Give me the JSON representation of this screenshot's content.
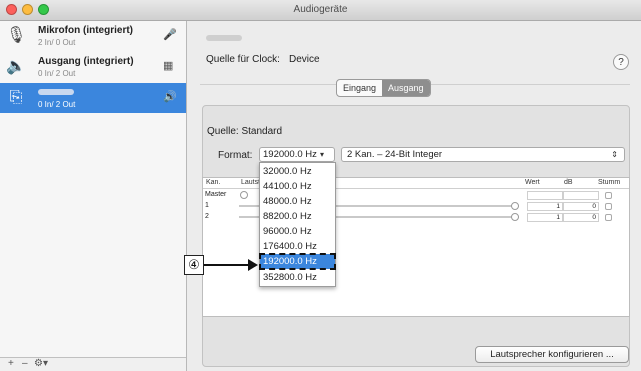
{
  "window": {
    "title": "Audiogeräte"
  },
  "sidebar": {
    "devices": [
      {
        "name": "Mikrofon (integriert)",
        "io": "2 In/ 0 Out",
        "icon": "microphone-icon"
      },
      {
        "name": "Ausgang (integriert)",
        "io": "0 In/ 2 Out",
        "icon": "speaker-icon"
      },
      {
        "name": "",
        "io": "0 In/ 2 Out",
        "icon": "usb-icon",
        "selected": true
      }
    ],
    "footer": {
      "add": "+",
      "remove": "–",
      "gear": "⚙▾"
    }
  },
  "main": {
    "clock_label": "Quelle für Clock:",
    "clock_value": "Device",
    "help": "?",
    "tabs": [
      {
        "label": "Eingang"
      },
      {
        "label": "Ausgang",
        "active": true
      }
    ],
    "source_label": "Quelle:",
    "source_value": "Standard",
    "format_label": "Format:",
    "format_value": "192000.0 Hz",
    "channels_value": "2 Kan. – 24-Bit Integer",
    "table": {
      "headers": {
        "kan": "Kan.",
        "laut": "Lautst",
        "wert": "Wert",
        "db": "dB",
        "stumm": "Stumm"
      },
      "rows": [
        {
          "label": "Master",
          "value": "",
          "db": ""
        },
        {
          "label": "1",
          "value": "1",
          "db": "0"
        },
        {
          "label": "2",
          "value": "1",
          "db": "0"
        }
      ]
    },
    "speaker_button": "Lautsprecher konfigurieren ..."
  },
  "dropdown": {
    "options": [
      "32000.0 Hz",
      "44100.0 Hz",
      "48000.0 Hz",
      "88200.0 Hz",
      "96000.0 Hz",
      "176400.0 Hz",
      "192000.0 Hz",
      "352800.0 Hz"
    ],
    "selected": "192000.0 Hz"
  },
  "callout": {
    "label": "④"
  },
  "colors": {
    "selection": "#3b86dd",
    "window_bg": "#ececec"
  }
}
